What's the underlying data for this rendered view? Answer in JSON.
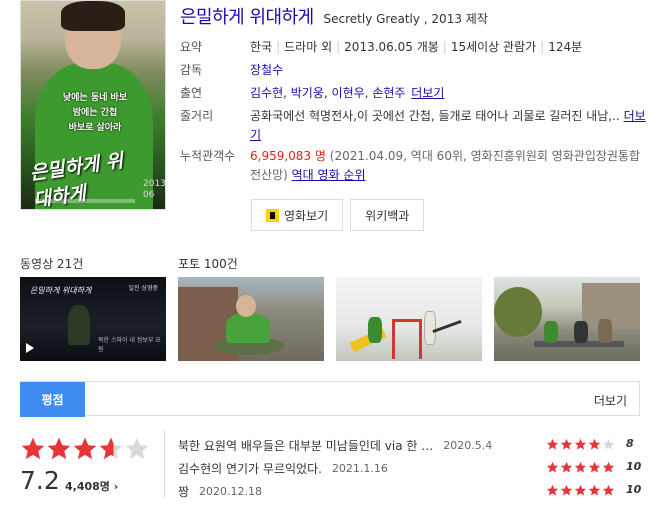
{
  "movie": {
    "title": "은밀하게 위대하게",
    "subtitle": "Secretly Greatly , 2013 제작"
  },
  "poster": {
    "tagline_lines": [
      "낮에는 동네 바보",
      "밤에는 간첩",
      "바보로 살아라"
    ],
    "title": "은밀하게 위대하게",
    "date": "2013\n06"
  },
  "info": {
    "summary_label": "요약",
    "summary_items": [
      "한국",
      "드라마 외",
      "2013.06.05 개봉",
      "15세이상 관람가",
      "124분"
    ],
    "director_label": "감독",
    "director": "장철수",
    "cast_label": "출연",
    "cast": [
      "김수현",
      "박기웅",
      "이현우",
      "손현주"
    ],
    "cast_more": "더보기",
    "plot_label": "줄거리",
    "plot": "공화국에선 혁명전사,이 곳에선 간첩, 들개로 태어나 괴물로 길러진 내남,..",
    "plot_more": "더보기",
    "audience_label": "누적관객수",
    "audience_value": "6,959,083 명",
    "audience_note": "(2021.04.09, 역대 60위, 영화진흥위원회 영화관입장권통합전산망)",
    "audience_rank_link": "역대 영화 순위"
  },
  "buttons": {
    "watch": "영화보기",
    "wiki": "위키백과"
  },
  "media": {
    "video_label": "동영상 21건",
    "photo_label": "포토 100건",
    "video_thumb_title": "은밀하게 위대하게",
    "video_thumb_caption": "북한 스파이 내 정보부 요원",
    "video_thumb_badge": "일진 상영중"
  },
  "rating": {
    "tab": "평점",
    "more": "더보기",
    "score": "7.2",
    "count": "4,408명",
    "star_fill": 0.72,
    "reviews": [
      {
        "text": "북한 요원역 배우들은 대부분 미남들인데 via 한 …",
        "date": "2020.5.4",
        "stars": 4,
        "score": "8"
      },
      {
        "text": "김수현의 연기가 무르익었다.",
        "date": "2021.1.16",
        "stars": 5,
        "score": "10"
      },
      {
        "text": "짱",
        "date": "2020.12.18",
        "stars": 5,
        "score": "10"
      }
    ]
  },
  "colors": {
    "accent": "#3e8cf0",
    "link": "#1a0dab",
    "star": "#e8353a",
    "star_empty": "#d9d9d9",
    "audience": "#d9261c"
  }
}
